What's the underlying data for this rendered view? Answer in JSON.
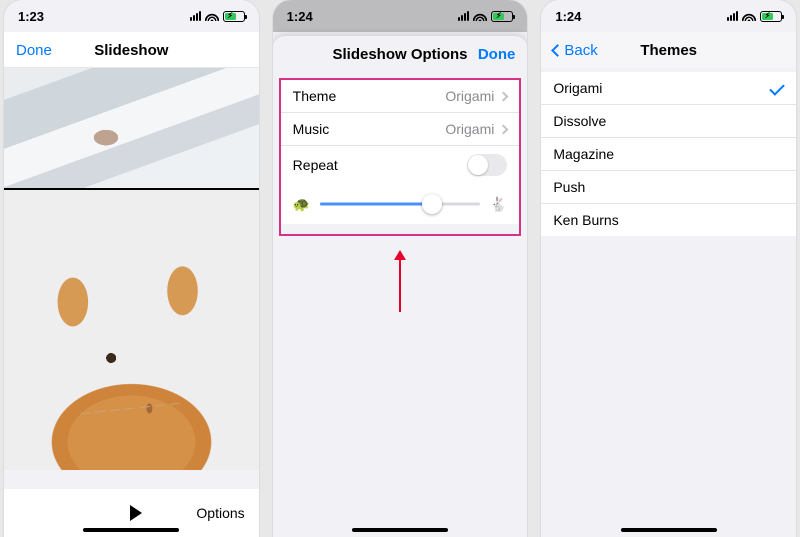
{
  "screen1": {
    "status": {
      "time": "1:23"
    },
    "nav": {
      "done": "Done",
      "title": "Slideshow"
    },
    "toolbar": {
      "options": "Options"
    }
  },
  "screen2": {
    "status": {
      "time": "1:24"
    },
    "nav": {
      "title": "Slideshow Options",
      "done": "Done"
    },
    "rows": {
      "theme_label": "Theme",
      "theme_value": "Origami",
      "music_label": "Music",
      "music_value": "Origami",
      "repeat_label": "Repeat",
      "repeat_on": false
    },
    "speed_slider": {
      "value": 0.7,
      "slow_icon": "🐢",
      "fast_icon": "🐇"
    }
  },
  "screen3": {
    "status": {
      "time": "1:24"
    },
    "nav": {
      "back": "Back",
      "title": "Themes"
    },
    "themes": [
      "Origami",
      "Dissolve",
      "Magazine",
      "Push",
      "Ken Burns"
    ],
    "selected_index": 0
  }
}
